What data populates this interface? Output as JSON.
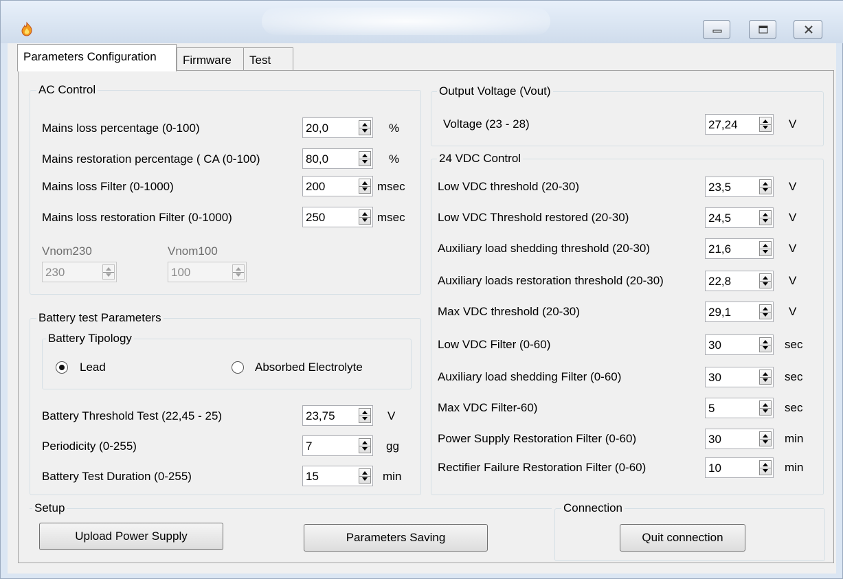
{
  "window": {
    "title": ""
  },
  "tabs": [
    "Parameters Configuration",
    "Firmware",
    "Test"
  ],
  "ac_control": {
    "title": "AC Control",
    "rows": [
      {
        "label": "Mains loss percentage (0-100)",
        "value": "20,0",
        "unit": "%"
      },
      {
        "label": "Mains restoration percentage ( CA (0-100)",
        "value": "80,0",
        "unit": "%"
      },
      {
        "label": "Mains loss  Filter (0-1000)",
        "value": "200",
        "unit": "msec"
      },
      {
        "label": "Mains loss restoration Filter (0-1000)",
        "value": "250",
        "unit": "msec"
      }
    ],
    "vnom230": {
      "label": "Vnom230",
      "value": "230"
    },
    "vnom100": {
      "label": "Vnom100",
      "value": "100"
    }
  },
  "battery": {
    "title": "Battery test Parameters",
    "tipology_title": "Battery Tipology",
    "options": [
      {
        "label": "Lead",
        "checked": true
      },
      {
        "label": "Absorbed Electrolyte",
        "checked": false
      }
    ],
    "rows": [
      {
        "label": "Battery Threshold Test (22,45 - 25)",
        "value": "23,75",
        "unit": "V"
      },
      {
        "label": "Periodicity (0-255)",
        "value": "7",
        "unit": "gg"
      },
      {
        "label": "Battery Test Duration (0-255)",
        "value": "15",
        "unit": "min"
      }
    ]
  },
  "output_voltage": {
    "title": "Output Voltage (Vout)",
    "label": "Voltage (23 - 28)",
    "value": "27,24",
    "unit": "V"
  },
  "vdc_control": {
    "title": "24 VDC Control",
    "rows": [
      {
        "label": "Low VDC threshold (20-30)",
        "value": "23,5",
        "unit": "V"
      },
      {
        "label": "Low VDC  Threshold restored (20-30)",
        "value": "24,5",
        "unit": "V"
      },
      {
        "label": "Auxiliary load shedding threshold (20-30)",
        "value": "21,6",
        "unit": "V"
      },
      {
        "label": "Auxiliary loads restoration threshold (20-30)",
        "value": "22,8",
        "unit": "V"
      },
      {
        "label": "Max VDC  threshold (20-30)",
        "value": "29,1",
        "unit": "V"
      },
      {
        "label": "Low VDC  Filter (0-60)",
        "value": "30",
        "unit": "sec"
      },
      {
        "label": "Auxiliary load shedding Filter  (0-60)",
        "value": "30",
        "unit": "sec"
      },
      {
        "label": "Max VDC  Filter-60)",
        "value": "5",
        "unit": "sec"
      },
      {
        "label": "Power Supply Restoration Filter (0-60)",
        "value": "30",
        "unit": "min"
      },
      {
        "label": "Rectifier Failure Restoration Filter (0-60)",
        "value": "10",
        "unit": "min"
      }
    ]
  },
  "setup": {
    "title": "Setup",
    "upload_label": "Upload Power Supply",
    "saving_label": "Parameters Saving"
  },
  "connection": {
    "title": "Connection",
    "quit_label": "Quit connection"
  }
}
